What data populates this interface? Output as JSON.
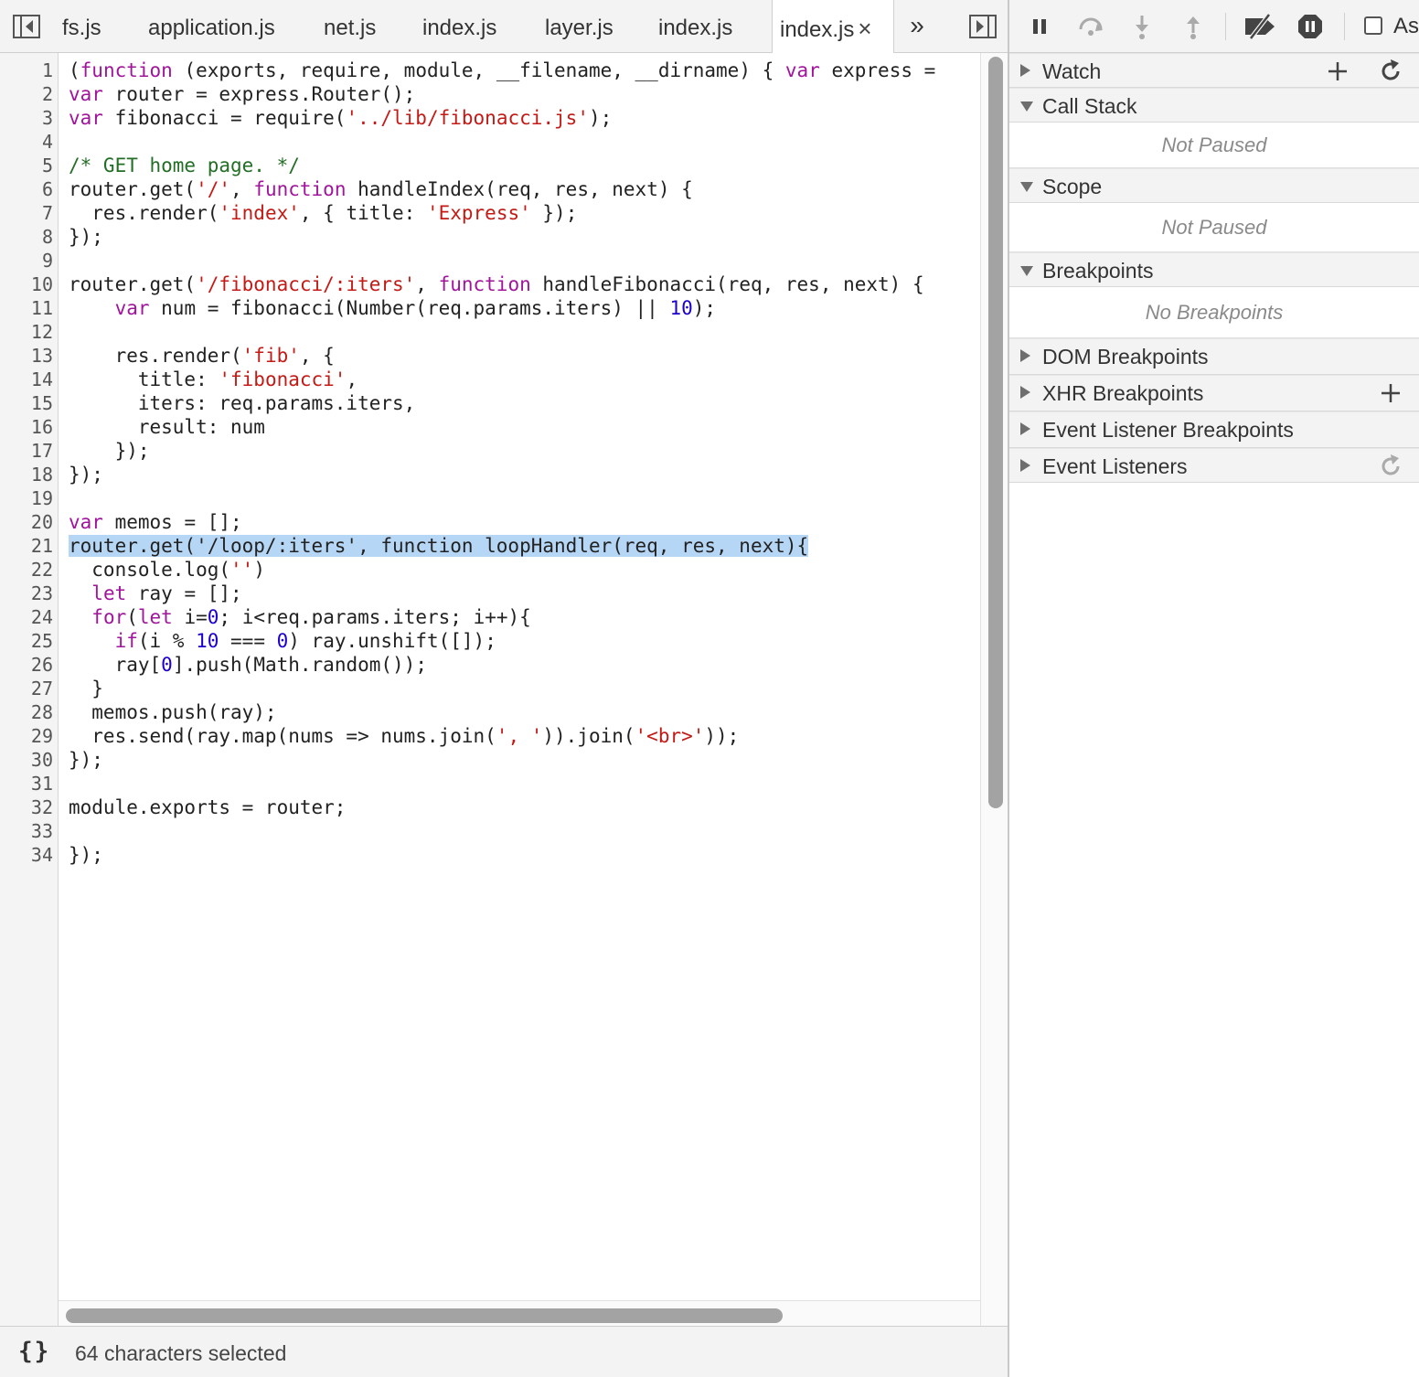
{
  "tabs": [
    {
      "label": "fs.js",
      "active": false
    },
    {
      "label": "application.js",
      "active": false
    },
    {
      "label": "net.js",
      "active": false
    },
    {
      "label": "index.js",
      "active": false
    },
    {
      "label": "layer.js",
      "active": false
    },
    {
      "label": "index.js",
      "active": false
    },
    {
      "label": "index.js",
      "active": true
    }
  ],
  "tab_close_glyph": "×",
  "more_tabs_glyph": "»",
  "line_numbers": [
    "1",
    "2",
    "3",
    "4",
    "5",
    "6",
    "7",
    "8",
    "9",
    "10",
    "11",
    "12",
    "13",
    "14",
    "15",
    "16",
    "17",
    "18",
    "19",
    "20",
    "21",
    "22",
    "23",
    "24",
    "25",
    "26",
    "27",
    "28",
    "29",
    "30",
    "31",
    "32",
    "33",
    "34"
  ],
  "code_lines": [
    "(function (exports, require, module, __filename, __dirname) { var express =",
    "var router = express.Router();",
    "var fibonacci = require('../lib/fibonacci.js');",
    "",
    "/* GET home page. */",
    "router.get('/', function handleIndex(req, res, next) {",
    "  res.render('index', { title: 'Express' });",
    "});",
    "",
    "router.get('/fibonacci/:iters', function handleFibonacci(req, res, next) {",
    "    var num = fibonacci(Number(req.params.iters) || 10);",
    "",
    "    res.render('fib', {",
    "      title: 'fibonacci',",
    "      iters: req.params.iters,",
    "      result: num",
    "    });",
    "});",
    "",
    "var memos = [];",
    "router.get('/loop/:iters', function loopHandler(req, res, next){",
    "  console.log('')",
    "  let ray = [];",
    "  for(let i=0; i<req.params.iters; i++){",
    "    if(i % 10 === 0) ray.unshift([]);",
    "    ray[0].push(Math.random());",
    "  }",
    "  memos.push(ray);",
    "  res.send(ray.map(nums => nums.join(', ')).join('<br>'));",
    "});",
    "",
    "module.exports = router;",
    "",
    "});"
  ],
  "selected_line": 21,
  "status": {
    "pretty_print": "{}",
    "text": "64 characters selected"
  },
  "debugger": {
    "async_label": "As",
    "toolbar_icons": [
      "pause-icon",
      "step-over-icon",
      "step-into-icon",
      "step-out-icon",
      "deactivate-breakpoints-icon",
      "pause-on-exceptions-icon"
    ],
    "sections": [
      {
        "title": "Watch",
        "open": false,
        "actions": [
          "add-icon",
          "refresh-icon"
        ]
      },
      {
        "title": "Call Stack",
        "open": true,
        "body": "Not Paused"
      },
      {
        "title": "Scope",
        "open": true,
        "body": "Not Paused"
      },
      {
        "title": "Breakpoints",
        "open": true,
        "body": "No Breakpoints"
      },
      {
        "title": "DOM Breakpoints",
        "open": false
      },
      {
        "title": "XHR Breakpoints",
        "open": false,
        "actions": [
          "add-icon"
        ]
      },
      {
        "title": "Event Listener Breakpoints",
        "open": false
      },
      {
        "title": "Event Listeners",
        "open": false,
        "actions": [
          "refresh-icon"
        ]
      }
    ]
  },
  "colors": {
    "keyword": "#a0159b",
    "string": "#c41a16",
    "number": "#1c00cf",
    "comment": "#236e25",
    "selection": "#b6d6f5"
  }
}
